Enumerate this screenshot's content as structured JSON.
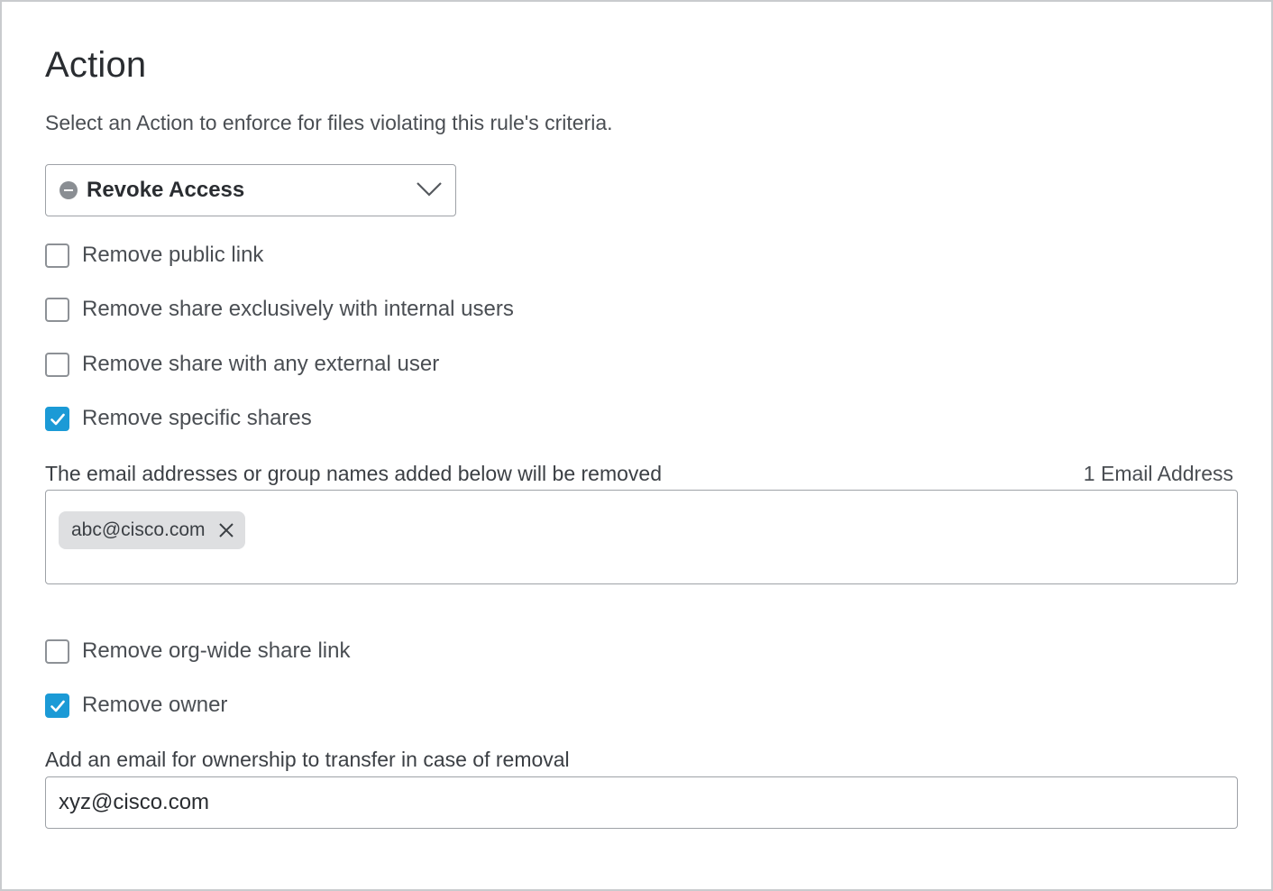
{
  "header": {
    "title": "Action",
    "subtitle": "Select an Action to enforce for files violating this rule's criteria."
  },
  "action_select": {
    "selected_label": "Revoke Access",
    "icon": "minus-circle-icon"
  },
  "options": [
    {
      "label": "Remove public link",
      "checked": false
    },
    {
      "label": "Remove share exclusively with internal users",
      "checked": false
    },
    {
      "label": "Remove share with any external user",
      "checked": false
    },
    {
      "label": "Remove specific shares",
      "checked": true
    },
    {
      "label": "Remove org-wide share link",
      "checked": false
    },
    {
      "label": "Remove owner",
      "checked": true
    }
  ],
  "specific_shares": {
    "label": "The email addresses or group names added below will be removed",
    "count_label": "1 Email Address",
    "emails": [
      "abc@cisco.com"
    ]
  },
  "owner_transfer": {
    "label": "Add an email for ownership to transfer in case of removal",
    "value": "xyz@cisco.com"
  },
  "colors": {
    "accent": "#1b9ad6",
    "border": "#9ea2a7",
    "chip_bg": "#dedfe1"
  }
}
